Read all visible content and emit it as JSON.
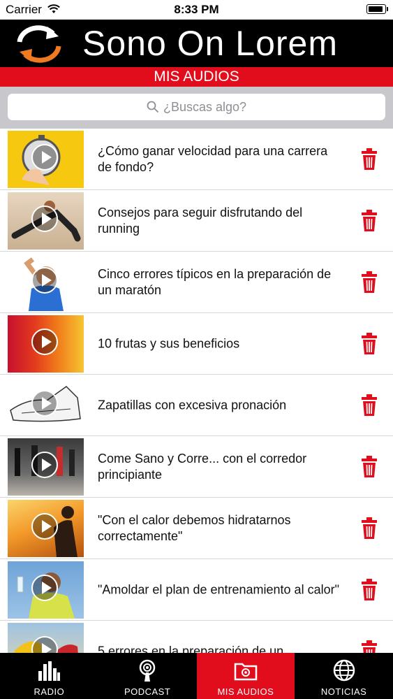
{
  "status_bar": {
    "carrier": "Carrier",
    "time": "8:33 PM",
    "battery_level": 0.9
  },
  "header": {
    "title": "Sono On Lorem"
  },
  "section": {
    "title": "MIS AUDIOS"
  },
  "search": {
    "placeholder": "¿Buscas algo?"
  },
  "audios": [
    {
      "title": "¿Cómo ganar velocidad para una carrera de fondo?"
    },
    {
      "title": "Consejos para seguir disfrutando del running"
    },
    {
      "title": "Cinco errores típicos en la preparación de un maratón"
    },
    {
      "title": "10 frutas y sus beneficios"
    },
    {
      "title": "Zapatillas con excesiva pronación"
    },
    {
      "title": "Come Sano y Corre... con el corredor principiante"
    },
    {
      "title": "\"Con el calor debemos hidratarnos correctamente\""
    },
    {
      "title": "\"Amoldar el plan de entrenamiento al calor\""
    },
    {
      "title": "5 errores en la preparación de un"
    }
  ],
  "tabs": [
    {
      "label": "RADIO"
    },
    {
      "label": "PODCAST"
    },
    {
      "label": "MIS AUDIOS"
    },
    {
      "label": "NOTICIAS"
    }
  ],
  "colors": {
    "accent": "#e20d1c",
    "header_bg": "#000000",
    "logo_orange": "#f07a22"
  }
}
